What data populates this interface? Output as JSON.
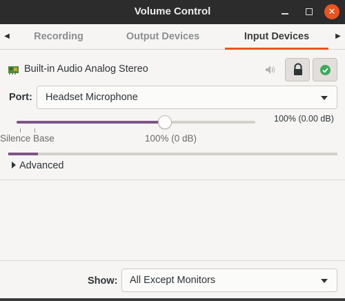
{
  "window": {
    "title": "Volume Control",
    "controls": [
      "minimize-icon",
      "maximize-icon",
      "close-icon"
    ]
  },
  "tabs": {
    "items": [
      {
        "label": "Recording",
        "selected": false
      },
      {
        "label": "Output Devices",
        "selected": false
      },
      {
        "label": "Input Devices",
        "selected": true
      }
    ],
    "left_arrow_icon": "chevron-left-icon",
    "right_arrow_icon": "chevron-right-icon"
  },
  "device": {
    "name": "Built-in Audio Analog Stereo",
    "icon": "sound-card-icon",
    "mute_icon": "speaker-muted-icon",
    "lock_icon": "lock-icon",
    "default_icon": "check-circle-icon",
    "port_label": "Port:",
    "port_value": "Headset Microphone",
    "volume_readout": "100% (0.00 dB)",
    "volume_fraction": 0.62,
    "scale_label_silence": "Silence",
    "scale_label_base": "Base",
    "scale_label_100": "100% (0 dB)",
    "level_fraction": 0.09,
    "advanced_label": "Advanced"
  },
  "footer": {
    "show_label": "Show:",
    "show_value": "All Except Monitors"
  },
  "colors": {
    "accent": "#e95420",
    "slider_fill": "#7e5585",
    "titlebar": "#2c2c2c",
    "default_check": "#3fa85c"
  }
}
